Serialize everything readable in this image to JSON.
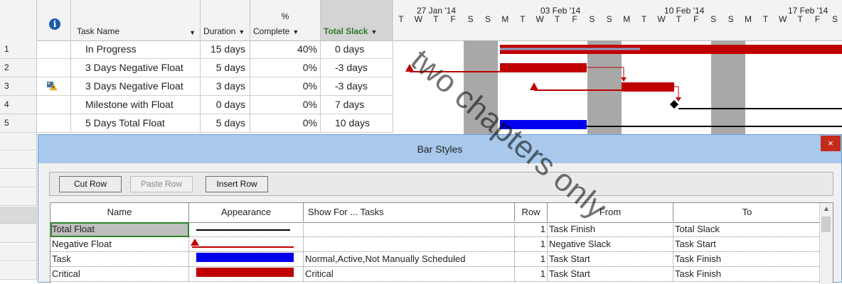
{
  "table": {
    "headers": {
      "task_name": "Task Name",
      "duration": "Duration",
      "complete_pct": "%",
      "complete": "Complete",
      "total_slack": "Total Slack"
    },
    "rows": [
      {
        "num": "1",
        "name": "In Progress",
        "duration": "15 days",
        "complete": "40%",
        "slack": "0 days"
      },
      {
        "num": "2",
        "name": "3 Days Negative Float",
        "duration": "5 days",
        "complete": "0%",
        "slack": "-3 days"
      },
      {
        "num": "3",
        "name": "3 Days Negative Float",
        "duration": "3 days",
        "complete": "0%",
        "slack": "-3 days"
      },
      {
        "num": "4",
        "name": "Milestone with Float",
        "duration": "0 days",
        "complete": "0%",
        "slack": "7 days"
      },
      {
        "num": "5",
        "name": "5 Days Total Float",
        "duration": "5 days",
        "complete": "0%",
        "slack": "10 days"
      }
    ]
  },
  "timeline": {
    "weeks": [
      "27 Jan '14",
      "03 Feb '14",
      "10 Feb '14",
      "17 Feb '14"
    ],
    "days": [
      "T",
      "W",
      "T",
      "F",
      "S",
      "S",
      "M",
      "T",
      "W",
      "T",
      "F",
      "S",
      "S",
      "M",
      "T",
      "W",
      "T",
      "F",
      "S",
      "S",
      "M",
      "T",
      "W",
      "T",
      "F",
      "S"
    ]
  },
  "dialog": {
    "title": "Bar Styles",
    "close": "×",
    "buttons": {
      "cut": "Cut Row",
      "paste": "Paste Row",
      "insert": "Insert Row"
    },
    "columns": {
      "name": "Name",
      "appearance": "Appearance",
      "show_for": "Show For ... Tasks",
      "row": "Row",
      "from": "From",
      "to": "To"
    },
    "rows": [
      {
        "name": "Total Float",
        "show_for": "",
        "row": "1",
        "from": "Task Finish",
        "to": "Total Slack"
      },
      {
        "name": "Negative Float",
        "show_for": "",
        "row": "1",
        "from": "Negative Slack",
        "to": "Task Start"
      },
      {
        "name": "Task",
        "show_for": "Normal,Active,Not Manually Scheduled",
        "row": "1",
        "from": "Task Start",
        "to": "Task Finish"
      },
      {
        "name": "Critical",
        "show_for": "Critical",
        "row": "1",
        "from": "Task Start",
        "to": "Task Finish"
      }
    ]
  },
  "watermark": "two chapters only",
  "colors": {
    "critical": "#c00000",
    "task": "#0000ff",
    "float": "#000000",
    "weekend": "#a8a8a8"
  }
}
